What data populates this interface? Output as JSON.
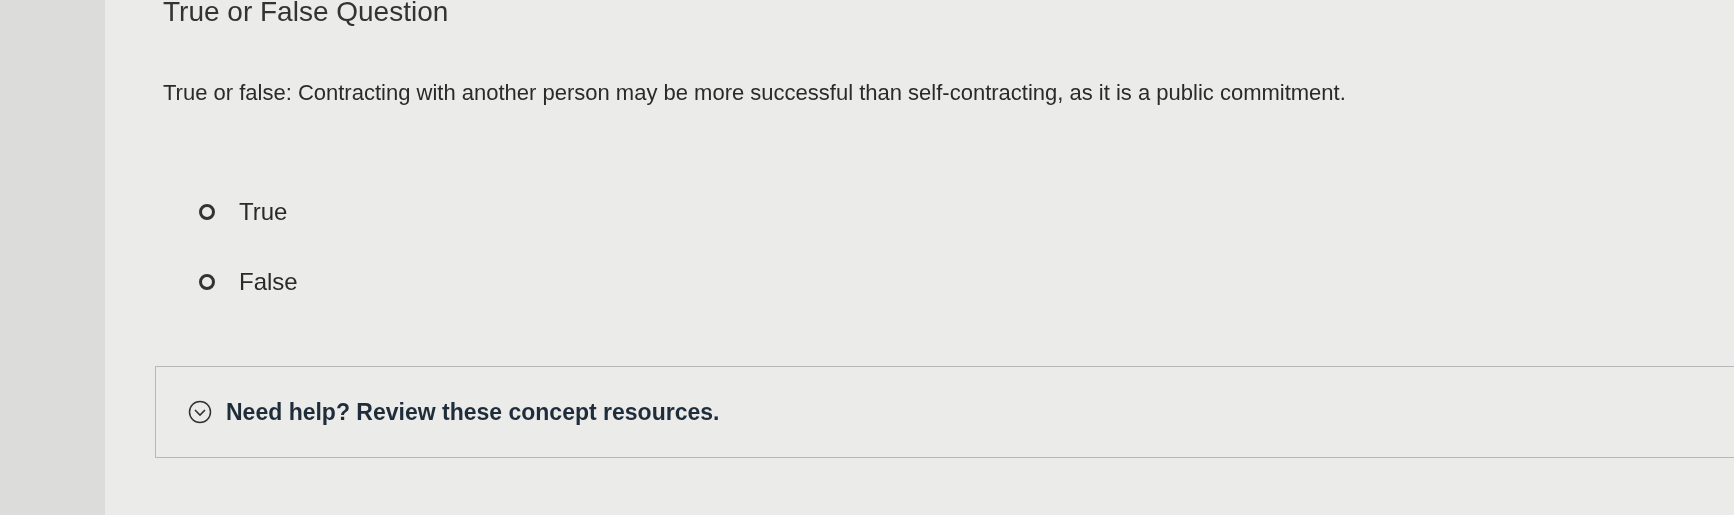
{
  "title": "True or False Question",
  "question": "True or false: Contracting with another person may be more successful than self-contracting, as it is a public commitment.",
  "options": [
    {
      "label": "True",
      "selected": false
    },
    {
      "label": "False",
      "selected": false
    }
  ],
  "help": {
    "label": "Need help? Review these concept resources.",
    "expanded": false
  }
}
